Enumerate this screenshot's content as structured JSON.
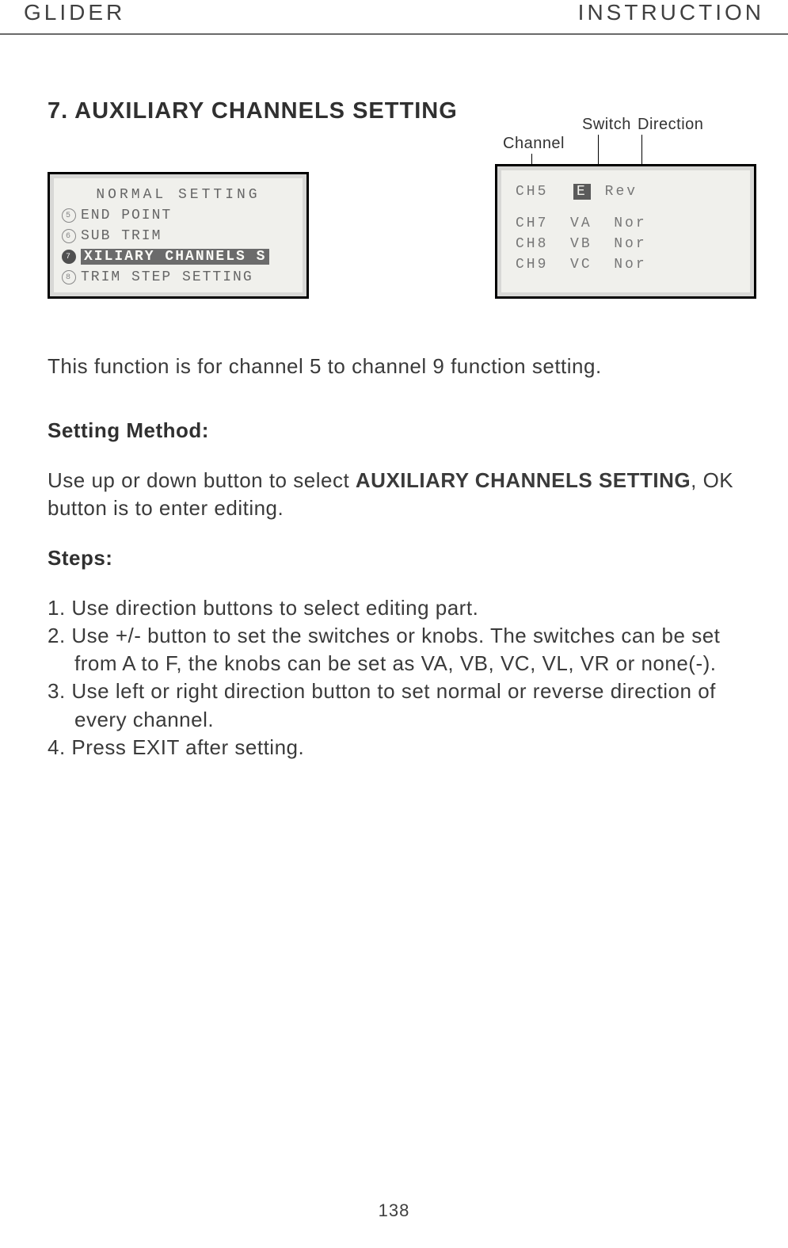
{
  "header": {
    "left": "GLIDER",
    "right": "INSTRUCTION"
  },
  "section_title": "7. AUXILIARY CHANNELS SETTING",
  "lcd_left": {
    "title": "NORMAL SETTING",
    "rows": [
      {
        "num": "5",
        "text": "END POINT"
      },
      {
        "num": "6",
        "text": "SUB TRIM"
      },
      {
        "num": "7",
        "text": "XILIARY CHANNELS S",
        "highlight": true
      },
      {
        "num": "8",
        "text": "TRIM STEP SETTING"
      }
    ]
  },
  "lcd_right": {
    "rows": [
      {
        "ch": "CH5",
        "sw": "E",
        "dir": "Rev",
        "sw_highlight": true
      },
      {
        "ch": "CH7",
        "sw": "VA",
        "dir": "Nor"
      },
      {
        "ch": "CH8",
        "sw": "VB",
        "dir": "Nor"
      },
      {
        "ch": "CH9",
        "sw": "VC",
        "dir": "Nor"
      }
    ]
  },
  "callouts": {
    "channel": "Channel",
    "switch": "Switch",
    "direction": "Direction"
  },
  "description": "This function is for channel 5 to channel 9 function setting.",
  "setting_method_h": "Setting Method:",
  "setting_method_p_pre": "Use up or down button to select ",
  "setting_method_p_bold": "AUXILIARY CHANNELS SETTING",
  "setting_method_p_post": ", OK button is to enter editing.",
  "steps_h": "Steps:",
  "steps": [
    "1. Use direction buttons to select editing part.",
    "2. Use +/- button to set the switches or knobs. The switches can be set from A to F, the knobs can be set as VA, VB, VC, VL, VR or none(-).",
    "3. Use left or right direction button to set normal or reverse direction of every channel.",
    "4. Press EXIT after setting."
  ],
  "page_number": "138"
}
